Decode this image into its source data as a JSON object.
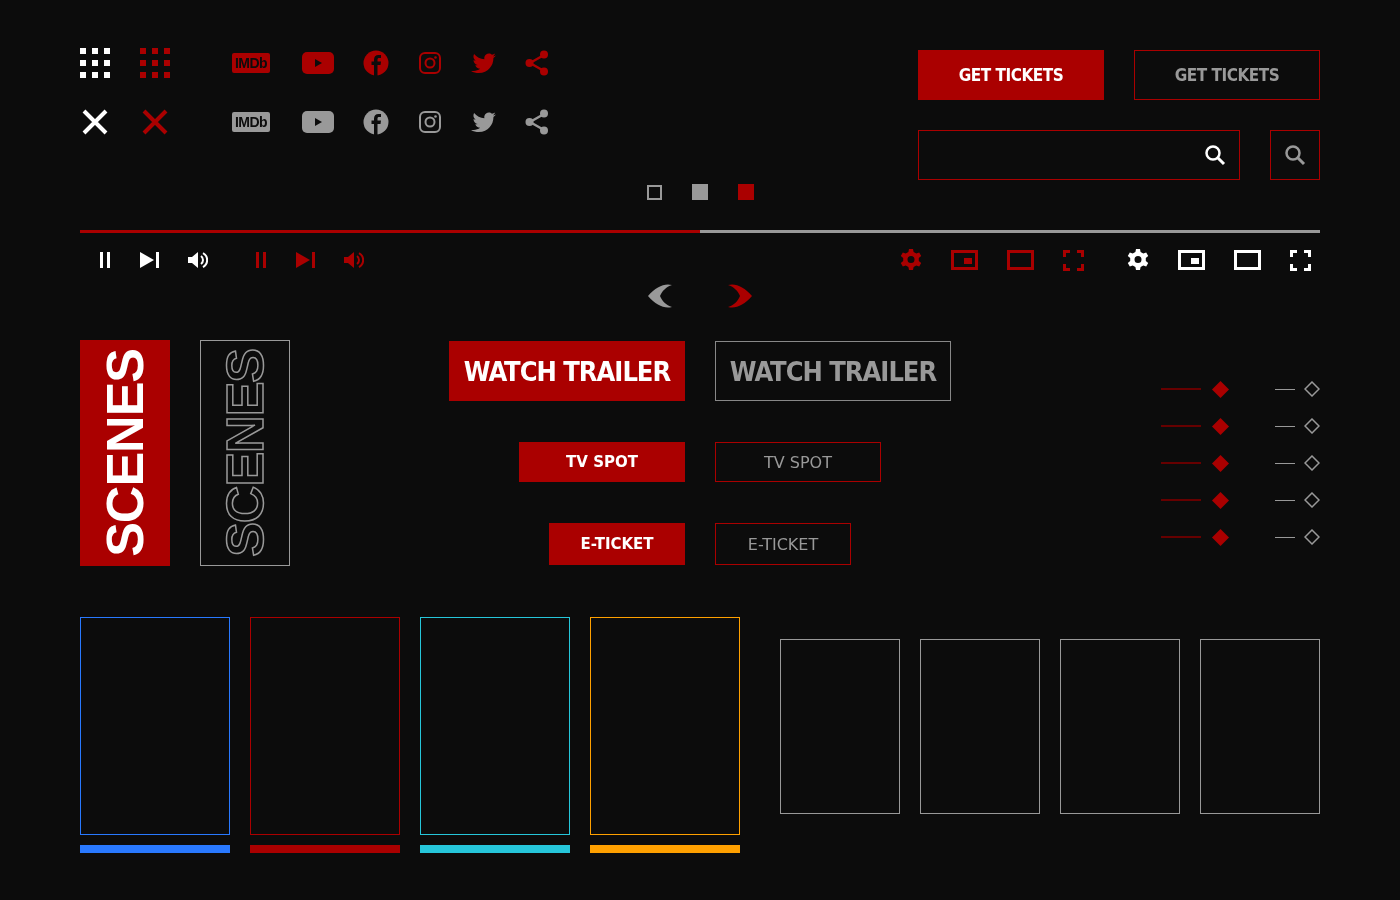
{
  "icon_rows": [
    {
      "kind": "accent",
      "imdb_label": "IMDb"
    },
    {
      "kind": "muted",
      "imdb_label": "IMDb"
    }
  ],
  "ticket_buttons": [
    {
      "label": "GET TICKETS",
      "kind": "filled"
    },
    {
      "label": "GET TICKETS",
      "kind": "outline"
    }
  ],
  "pager": [
    {
      "kind": "empty"
    },
    {
      "kind": "grey"
    },
    {
      "kind": "red"
    }
  ],
  "progress": {
    "level": 0.5
  },
  "scenes_tabs": [
    {
      "label": "SCENES",
      "kind": "filled"
    },
    {
      "label": "SCENES",
      "kind": "outline"
    }
  ],
  "action_buttons": [
    {
      "label": "WATCH TRAILER",
      "kind": "filled"
    },
    {
      "label": "WATCH TRAILER",
      "kind": "outline"
    },
    {
      "label": "TV SPOT",
      "kind": "filled"
    },
    {
      "label": "TV SPOT",
      "kind": "outline"
    },
    {
      "label": "E-TICKET",
      "kind": "filled"
    },
    {
      "label": "E-TICKET",
      "kind": "outline"
    }
  ],
  "cards": [
    {
      "color": "#2979ff"
    },
    {
      "color": "#aa0000"
    },
    {
      "color": "#26c6da"
    },
    {
      "color": "#ffa000"
    }
  ]
}
